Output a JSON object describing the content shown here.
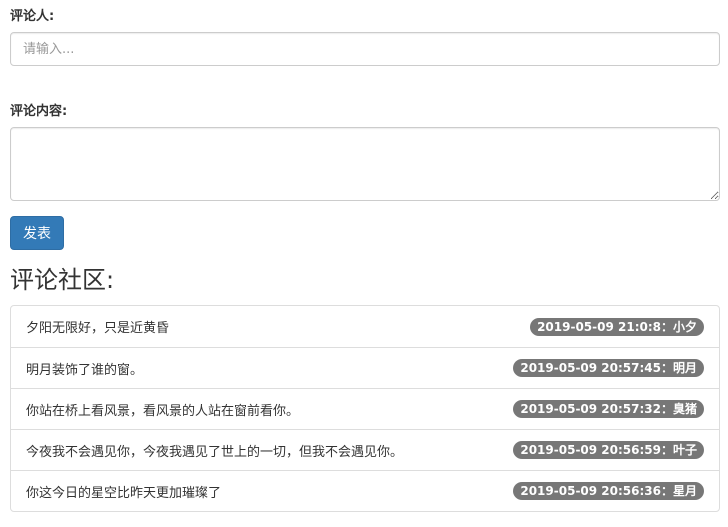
{
  "form": {
    "commenter_label": "评论人:",
    "commenter_placeholder": "请输入...",
    "content_label": "评论内容:",
    "content_value": "",
    "submit_label": "发表"
  },
  "community": {
    "heading": "评论社区:",
    "comments": [
      {
        "text": "夕阳无限好，只是近黄昏",
        "meta": "2019-05-09 21:0:8：小夕"
      },
      {
        "text": "明月装饰了谁的窗。",
        "meta": "2019-05-09 20:57:45：明月"
      },
      {
        "text": "你站在桥上看风景，看风景的人站在窗前看你。",
        "meta": "2019-05-09 20:57:32：臭猪"
      },
      {
        "text": "今夜我不会遇见你，今夜我遇见了世上的一切，但我不会遇见你。",
        "meta": "2019-05-09 20:56:59：叶子"
      },
      {
        "text": "你这今日的星空比昨天更加璀璨了",
        "meta": "2019-05-09 20:56:36：星月"
      }
    ]
  },
  "colors": {
    "primary": "#337ab7",
    "badge": "#777777",
    "border": "#dddddd"
  }
}
